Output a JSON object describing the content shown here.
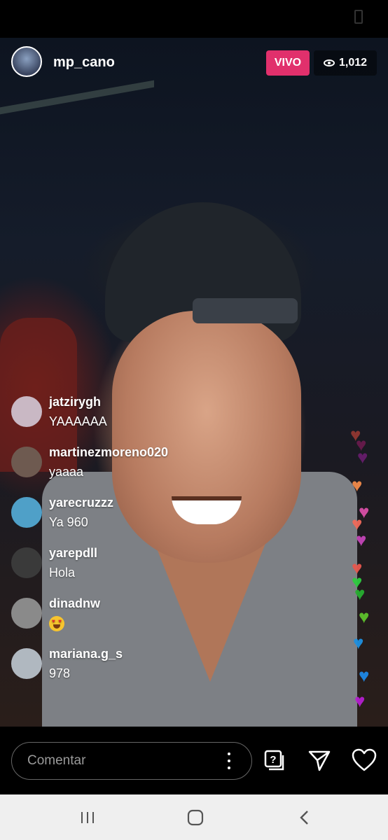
{
  "header": {
    "username": "mp_cano",
    "live_label": "VIVO",
    "viewer_count": "1,012"
  },
  "comments": [
    {
      "user": "jatzirygh",
      "text": "YAAAAAA",
      "avatar_color": "#c9b8c4"
    },
    {
      "user": "martinezmoreno020",
      "text": "yaaaa",
      "avatar_color": "#6e5a50"
    },
    {
      "user": "yarecruzzz",
      "text": "Ya 960",
      "avatar_color": "#4fa0c8"
    },
    {
      "user": "yarepdll",
      "text": "Hola",
      "avatar_color": "#3a3a3a"
    },
    {
      "user": "dinadnw",
      "text": "",
      "emoji": "heart-eyes-emoji",
      "avatar_color": "#8a8a8a"
    },
    {
      "user": "mariana.g_s",
      "text": "978",
      "avatar_color": "#b0b8c0"
    }
  ],
  "hearts": [
    {
      "color": "#e74c3c"
    },
    {
      "color": "#a01a6a"
    },
    {
      "color": "#9b1fa0"
    },
    {
      "color": "#f08a4b"
    },
    {
      "color": "#d84fa6"
    },
    {
      "color": "#f06a5a"
    },
    {
      "color": "#c445b8"
    },
    {
      "color": "#e8574e"
    },
    {
      "color": "#2ecc40"
    },
    {
      "color": "#27ae30"
    },
    {
      "color": "#5dc12c"
    },
    {
      "color": "#1e90e0"
    },
    {
      "color": "#1e88e5"
    },
    {
      "color": "#b51fd0"
    },
    {
      "color": "#7a1a8a"
    }
  ],
  "footer": {
    "comment_placeholder": "Comentar"
  },
  "icons": {
    "more": "more-options-icon",
    "question": "question-sticker-icon",
    "send": "send-icon",
    "like": "heart-icon"
  }
}
